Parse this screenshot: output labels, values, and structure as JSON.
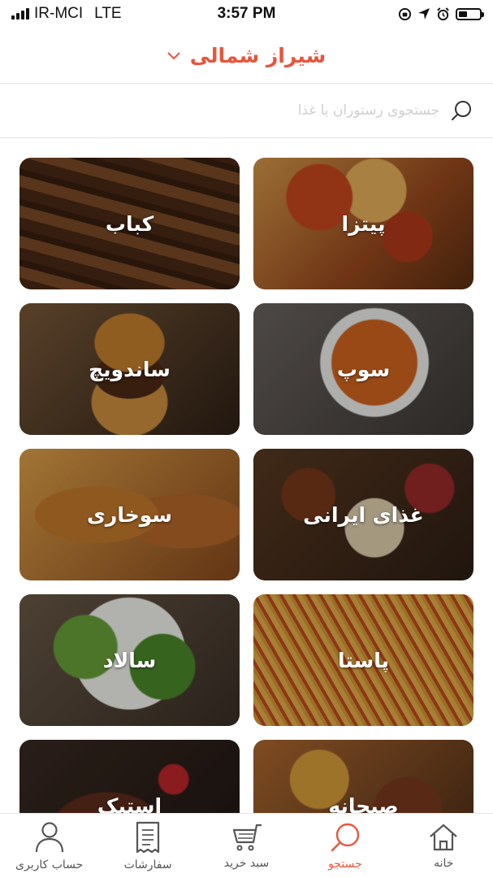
{
  "status_bar": {
    "carrier": "IR-MCI",
    "network": "LTE",
    "time": "3:57 PM"
  },
  "header": {
    "city": "شیراز شمالی"
  },
  "search": {
    "placeholder": "جستجوی رستوران یا غذا"
  },
  "categories": [
    {
      "label": "پیتزا"
    },
    {
      "label": "کباب"
    },
    {
      "label": "سوپ"
    },
    {
      "label": "ساندویچ"
    },
    {
      "label": "غذای ایرانی"
    },
    {
      "label": "سوخاری"
    },
    {
      "label": "پاستا"
    },
    {
      "label": "سالاد"
    },
    {
      "label": "صبحانه"
    },
    {
      "label": "استیک"
    }
  ],
  "tabbar": {
    "items": [
      {
        "label": "خانه",
        "icon": "home-icon"
      },
      {
        "label": "جستجو",
        "icon": "search-icon",
        "active": true
      },
      {
        "label": "سبد خرید",
        "icon": "cart-icon"
      },
      {
        "label": "سفارشات",
        "icon": "receipt-icon"
      },
      {
        "label": "حساب کاربری",
        "icon": "user-icon"
      }
    ]
  },
  "colors": {
    "accent": "#e8553c",
    "inactive_icon": "#555555"
  }
}
